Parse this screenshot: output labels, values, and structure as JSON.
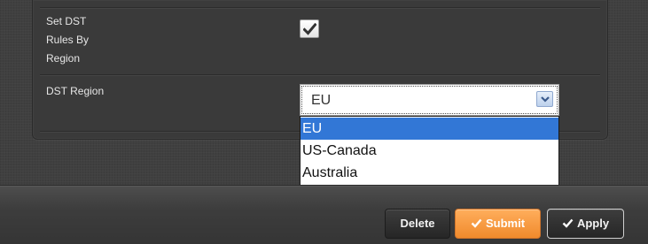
{
  "form": {
    "set_dst_label": "Set DST\nRules By\nRegion",
    "set_dst_checked": true,
    "dst_region_label": "DST Region",
    "dst_region_value": "EU",
    "dst_region_options": [
      "EU",
      "US-Canada",
      "Australia"
    ],
    "dst_region_highlighted": "EU"
  },
  "footer": {
    "delete_label": "Delete",
    "submit_label": "Submit",
    "apply_label": "Apply"
  },
  "colors": {
    "accent_orange": "#f59331",
    "selection_blue": "#3277d6",
    "background": "#404040"
  }
}
